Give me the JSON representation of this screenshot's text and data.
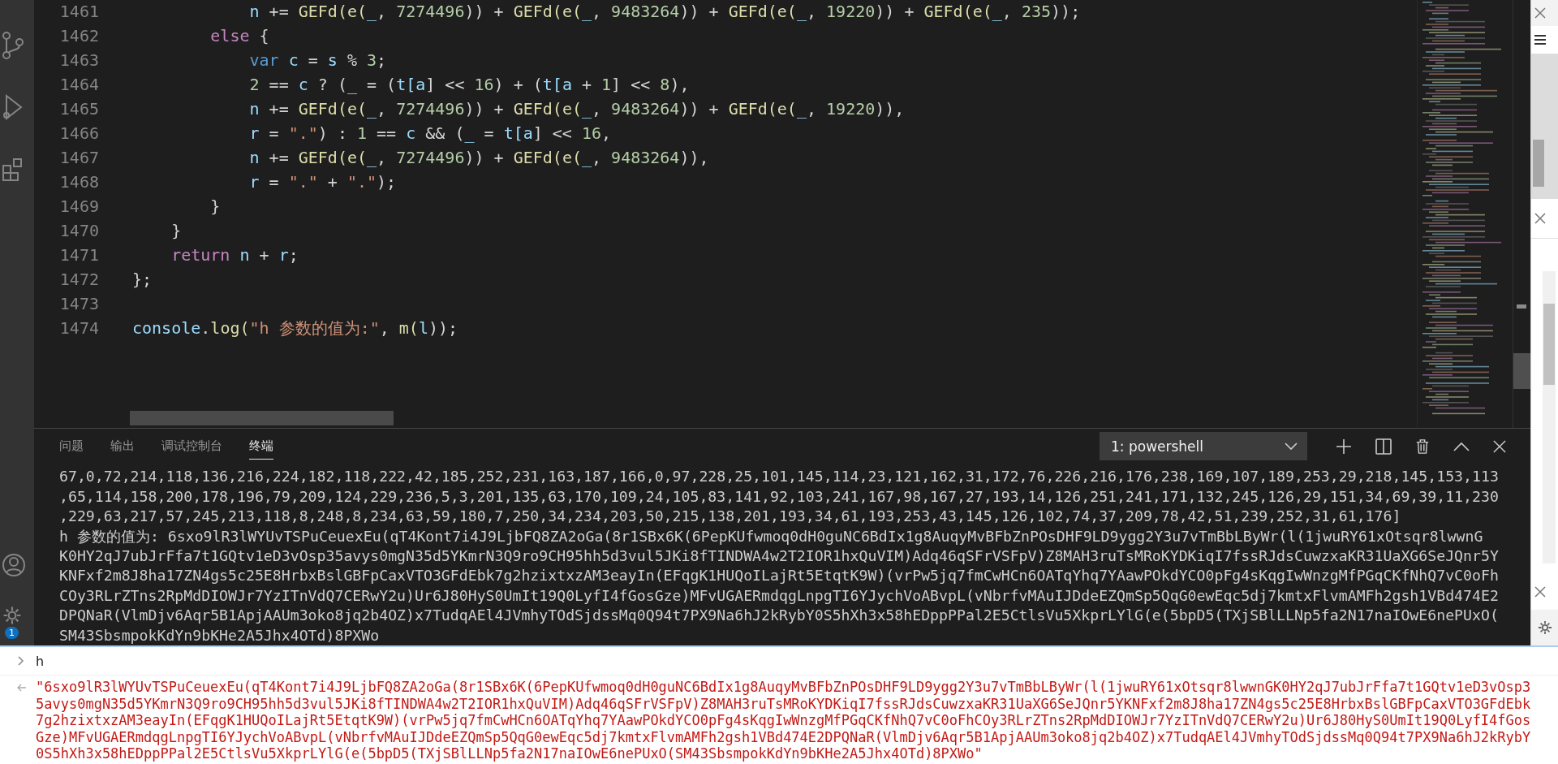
{
  "activity_bar": {
    "badge": "1"
  },
  "editor": {
    "lines": [
      {
        "number": "1461",
        "tokens": [
          {
            "text": "            n",
            "kind": "variable"
          },
          {
            "text": " += ",
            "kind": "plain"
          },
          {
            "text": "GEFd(e(",
            "kind": "function"
          },
          {
            "text": "_",
            "kind": "variable"
          },
          {
            "text": ", ",
            "kind": "plain"
          },
          {
            "text": "7274496",
            "kind": "number"
          },
          {
            "text": ")) + ",
            "kind": "plain"
          },
          {
            "text": "GEFd(e(",
            "kind": "function"
          },
          {
            "text": "_",
            "kind": "variable"
          },
          {
            "text": ", ",
            "kind": "plain"
          },
          {
            "text": "9483264",
            "kind": "number"
          },
          {
            "text": ")) + ",
            "kind": "plain"
          },
          {
            "text": "GEFd(e(",
            "kind": "function"
          },
          {
            "text": "_",
            "kind": "variable"
          },
          {
            "text": ", ",
            "kind": "plain"
          },
          {
            "text": "19220",
            "kind": "number"
          },
          {
            "text": ")) + ",
            "kind": "plain"
          },
          {
            "text": "GEFd(e(",
            "kind": "function"
          },
          {
            "text": "_",
            "kind": "variable"
          },
          {
            "text": ", ",
            "kind": "plain"
          },
          {
            "text": "235",
            "kind": "number"
          },
          {
            "text": "));",
            "kind": "plain"
          }
        ]
      },
      {
        "number": "1462",
        "tokens": [
          {
            "text": "        else",
            "kind": "keyword"
          },
          {
            "text": " {",
            "kind": "plain"
          }
        ]
      },
      {
        "number": "1463",
        "tokens": [
          {
            "text": "            var ",
            "kind": "storage"
          },
          {
            "text": "c",
            "kind": "variable"
          },
          {
            "text": " = ",
            "kind": "plain"
          },
          {
            "text": "s",
            "kind": "variable"
          },
          {
            "text": " % ",
            "kind": "plain"
          },
          {
            "text": "3",
            "kind": "number"
          },
          {
            "text": ";",
            "kind": "plain"
          }
        ]
      },
      {
        "number": "1464",
        "tokens": [
          {
            "text": "            2",
            "kind": "number"
          },
          {
            "text": " == ",
            "kind": "plain"
          },
          {
            "text": "c",
            "kind": "variable"
          },
          {
            "text": " ? (",
            "kind": "plain"
          },
          {
            "text": "_",
            "kind": "variable"
          },
          {
            "text": " = (",
            "kind": "plain"
          },
          {
            "text": "t[a",
            "kind": "variable"
          },
          {
            "text": "] << ",
            "kind": "plain"
          },
          {
            "text": "16",
            "kind": "number"
          },
          {
            "text": ") + (",
            "kind": "plain"
          },
          {
            "text": "t[a",
            "kind": "variable"
          },
          {
            "text": " + ",
            "kind": "plain"
          },
          {
            "text": "1",
            "kind": "number"
          },
          {
            "text": "] << ",
            "kind": "plain"
          },
          {
            "text": "8",
            "kind": "number"
          },
          {
            "text": "),",
            "kind": "plain"
          }
        ]
      },
      {
        "number": "1465",
        "tokens": [
          {
            "text": "            n",
            "kind": "variable"
          },
          {
            "text": " += ",
            "kind": "plain"
          },
          {
            "text": "GEFd(e(",
            "kind": "function"
          },
          {
            "text": "_",
            "kind": "variable"
          },
          {
            "text": ", ",
            "kind": "plain"
          },
          {
            "text": "7274496",
            "kind": "number"
          },
          {
            "text": ")) + ",
            "kind": "plain"
          },
          {
            "text": "GEFd(e(",
            "kind": "function"
          },
          {
            "text": "_",
            "kind": "variable"
          },
          {
            "text": ", ",
            "kind": "plain"
          },
          {
            "text": "9483264",
            "kind": "number"
          },
          {
            "text": ")) + ",
            "kind": "plain"
          },
          {
            "text": "GEFd(e(",
            "kind": "function"
          },
          {
            "text": "_",
            "kind": "variable"
          },
          {
            "text": ", ",
            "kind": "plain"
          },
          {
            "text": "19220",
            "kind": "number"
          },
          {
            "text": ")),",
            "kind": "plain"
          }
        ]
      },
      {
        "number": "1466",
        "tokens": [
          {
            "text": "            r",
            "kind": "variable"
          },
          {
            "text": " = ",
            "kind": "plain"
          },
          {
            "text": "\".\"",
            "kind": "string"
          },
          {
            "text": ") : ",
            "kind": "plain"
          },
          {
            "text": "1",
            "kind": "number"
          },
          {
            "text": " == ",
            "kind": "plain"
          },
          {
            "text": "c",
            "kind": "variable"
          },
          {
            "text": " && (",
            "kind": "plain"
          },
          {
            "text": "_",
            "kind": "variable"
          },
          {
            "text": " = ",
            "kind": "plain"
          },
          {
            "text": "t[a",
            "kind": "variable"
          },
          {
            "text": "] << ",
            "kind": "plain"
          },
          {
            "text": "16",
            "kind": "number"
          },
          {
            "text": ",",
            "kind": "plain"
          }
        ]
      },
      {
        "number": "1467",
        "tokens": [
          {
            "text": "            n",
            "kind": "variable"
          },
          {
            "text": " += ",
            "kind": "plain"
          },
          {
            "text": "GEFd(e(",
            "kind": "function"
          },
          {
            "text": "_",
            "kind": "variable"
          },
          {
            "text": ", ",
            "kind": "plain"
          },
          {
            "text": "7274496",
            "kind": "number"
          },
          {
            "text": ")) + ",
            "kind": "plain"
          },
          {
            "text": "GEFd(e(",
            "kind": "function"
          },
          {
            "text": "_",
            "kind": "variable"
          },
          {
            "text": ", ",
            "kind": "plain"
          },
          {
            "text": "9483264",
            "kind": "number"
          },
          {
            "text": ")),",
            "kind": "plain"
          }
        ]
      },
      {
        "number": "1468",
        "tokens": [
          {
            "text": "            r",
            "kind": "variable"
          },
          {
            "text": " = ",
            "kind": "plain"
          },
          {
            "text": "\".\"",
            "kind": "string"
          },
          {
            "text": " + ",
            "kind": "plain"
          },
          {
            "text": "\".\"",
            "kind": "string"
          },
          {
            "text": ");",
            "kind": "plain"
          }
        ]
      },
      {
        "number": "1469",
        "tokens": [
          {
            "text": "        }",
            "kind": "plain"
          }
        ]
      },
      {
        "number": "1470",
        "tokens": [
          {
            "text": "    }",
            "kind": "plain"
          }
        ]
      },
      {
        "number": "1471",
        "tokens": [
          {
            "text": "    return ",
            "kind": "keyword"
          },
          {
            "text": "n",
            "kind": "variable"
          },
          {
            "text": " + ",
            "kind": "plain"
          },
          {
            "text": "r",
            "kind": "variable"
          },
          {
            "text": ";",
            "kind": "plain"
          }
        ]
      },
      {
        "number": "1472",
        "tokens": [
          {
            "text": "};",
            "kind": "plain"
          }
        ]
      },
      {
        "number": "1473"
      },
      {
        "number": "1474",
        "tokens": [
          {
            "text": "console",
            "kind": "variable"
          },
          {
            "text": ".",
            "kind": "plain"
          },
          {
            "text": "log(",
            "kind": "function"
          },
          {
            "text": "\"h 参数的值为:\"",
            "kind": "string"
          },
          {
            "text": ", ",
            "kind": "plain"
          },
          {
            "text": "m(",
            "kind": "function"
          },
          {
            "text": "l",
            "kind": "variable"
          },
          {
            "text": "));",
            "kind": "plain"
          }
        ]
      }
    ]
  },
  "panel": {
    "tabs": [
      {
        "label": "问题",
        "selected": false
      },
      {
        "label": "输出",
        "selected": false
      },
      {
        "label": "调试控制台",
        "selected": false
      },
      {
        "label": "终端",
        "selected": true
      }
    ],
    "terminal_select": "1: powershell",
    "terminal_lines": [
      "67,0,72,214,118,136,216,224,182,118,222,42,185,252,231,163,187,166,0,97,228,25,101,145,114,23,121,162,31,172,76,226,216,176,238,169,107,189,253,29,218,145,153,113",
      ",65,114,158,200,178,196,79,209,124,229,236,5,3,201,135,63,170,109,24,105,83,141,92,103,241,167,98,167,27,193,14,126,251,241,171,132,245,126,29,151,34,69,39,11,230",
      ",229,63,217,57,245,213,118,8,248,8,234,63,59,180,7,250,34,234,203,50,215,138,201,193,34,61,193,253,43,145,126,102,74,37,209,78,42,51,239,252,31,61,176]",
      "h 参数的值为: 6sxo9lR3lWYUvTSPuCeuexEu(qT4Kont7i4J9LjbFQ8ZA2oGa(8r1SBx6K(6PepKUfwmoq0dH0guNC6BdIx1g8AuqyMvBFbZnPOsDHF9LD9ygg2Y3u7vTmBbLByWr(l(1jwuRY61xOtsqr8lwwnG",
      "K0HY2qJ7ubJrFfa7t1GQtv1eD3vOsp35avys0mgN35d5YKmrN3Q9ro9CH95hh5d3vul5JKi8fTINDWA4w2T2IOR1hxQuVIM)Adq46qSFrVSFpV)Z8MAH3ruTsMRoKYDKiqI7fssRJdsCuwzxaKR31UaXG6SeJQnr5Y",
      "KNFxf2m8J8ha17ZN4gs5c25E8HrbxBslGBFpCaxVTO3GFdEbk7g2hzixtxzAM3eayIn(EFqgK1HUQoILajRt5EtqtK9W)(vrPw5jq7fmCwHCn6OATqYhq7YAawPOkdYCO0pFg4sKqgIwWnzgMfPGqCKfNhQ7vC0oFh",
      "COy3RLrZTns2RpMdDIOWJr7YzITnVdQ7CERwY2u)Ur6J80HyS0UmIt19Q0LyfI4fGosGze)MFvUGAERmdqgLnpgTI6YJychVoABvpL(vNbrfvMAuIJDdeEZQmSp5QqG0ewEqc5dj7kmtxFlvmAMFh2gsh1VBd474E2",
      "DPQNaR(VlmDjv6Aqr5B1ApjAAUm3oko8jq2b4OZ)x7TudqAEl4JVmhyTOdSjdssMq0Q94t7PX9Na6hJ2kRybY0S5hXh3x58hEDppPPal2E5CtlsVu5XkprLYlG(e(5bpD5(TXjSBlLLNp5fa2N17naIOwE6nePUxO(",
      "SM43SbsmpokKdYn9bKHe2A5Jhx4OTd)8PXWo"
    ]
  },
  "console": {
    "input": "h",
    "output_lines": [
      "\"6sxo9lR3lWYUvTSPuCeuexEu(qT4Kont7i4J9LjbFQ8ZA2oGa(8r1SBx6K(6PepKUfwmoq0dH0guNC6BdIx1g8AuqyMvBFbZnPOsDHF9LD9ygg2Y3u7vTmBbLByWr(l(1jwuRY61xOtsqr8lwwnGK0HY2qJ7ubJrFfa7t1GQtv1eD3vOsp3",
      "5avys0mgN35d5YKmrN3Q9ro9CH95hh5d3vul5JKi8fTINDWA4w2T2IOR1hxQuVIM)Adq46qSFrVSFpV)Z8MAH3ruTsMRoKYDKiqI7fssRJdsCuwzxaKR31UaXG6SeJQnr5YKNFxf2m8J8ha17ZN4gs5c25E8HrbxBslGBFpCaxVTO3GFdEbk",
      "7g2hzixtxzAM3eayIn(EFqgK1HUQoILajRt5EtqtK9W)(vrPw5jq7fmCwHCn6OATqYhq7YAawPOkdYCO0pFg4sKqgIwWnzgMfPGqCKfNhQ7vC0oFhCOy3RLrZTns2RpMdDIOWJr7YzITnVdQ7CERwY2u)Ur6J80HyS0UmIt19Q0LyfI4fGos",
      "Gze)MFvUGAERmdqgLnpgTI6YJychVoABvpL(vNbrfvMAuIJDdeEZQmSp5QqG0ewEqc5dj7kmtxFlvmAMFh2gsh1VBd474E2DPQNaR(VlmDjv6Aqr5B1ApjAAUm3oko8jq2b4OZ)x7TudqAEl4JVmhyTOdSjdssMq0Q94t7PX9Na6hJ2kRybY",
      "0S5hXh3x58hEDppPPal2E5CtlsVu5XkprLYlG(e(5bpD5(TXjSBlLLNp5fa2N17naIOwE6nePUxO(SM43SbsmpokKdYn9bKHe2A5Jhx4OTd)8PXWo\""
    ]
  }
}
